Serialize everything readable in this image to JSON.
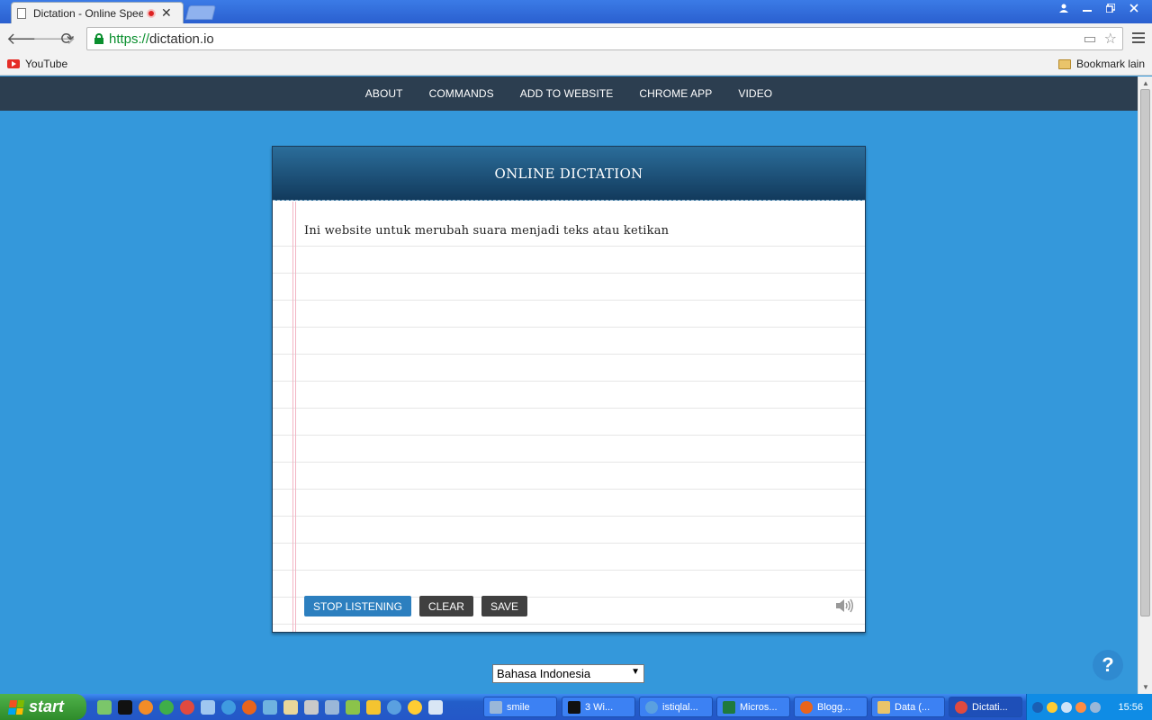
{
  "browser": {
    "tab_title": "Dictation - Online Speech",
    "tab_close": "✕",
    "url_scheme": "https://",
    "url_host": "dictation.io",
    "back_icon": "🡐",
    "forward_icon": "🡒",
    "reload_icon": "⟳",
    "star_icon": "☆",
    "camera_icon": "▭",
    "bookmarks": {
      "youtube_label": "YouTube",
      "other_label": "Bookmark lain"
    }
  },
  "site": {
    "nav": [
      "ABOUT",
      "COMMANDS",
      "ADD TO WEBSITE",
      "CHROME APP",
      "VIDEO"
    ],
    "card_title": "ONLINE DICTATION",
    "dictation_text": "Ini website untuk merubah suara menjadi teks atau ketikan",
    "buttons": {
      "stop_listening": "STOP LISTENING",
      "clear": "CLEAR",
      "save": "SAVE"
    },
    "language_selected": "Bahasa Indonesia",
    "help_label": "?"
  },
  "taskbar": {
    "start_label": "start",
    "tasks": [
      "smile",
      "3 Wi...",
      "istiqlal...",
      "Micros...",
      "Blogg...",
      "Data (...",
      "Dictati..."
    ],
    "clock": "15:56"
  },
  "colors": {
    "page_bg": "#3498db",
    "site_nav_bg": "#2c3e50",
    "card_header": "#1a4f78",
    "primary_button": "#2c7fbf",
    "dark_button": "#404040"
  }
}
